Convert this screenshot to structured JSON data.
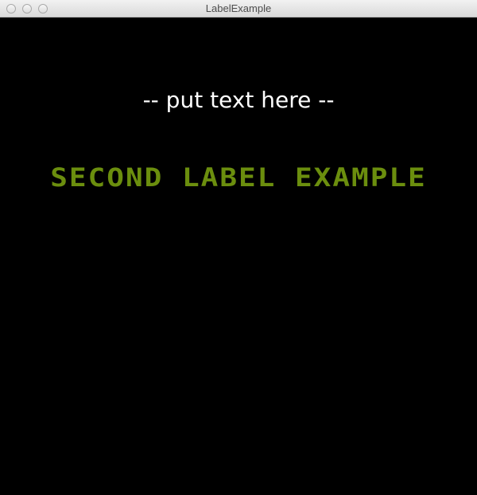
{
  "window": {
    "title": "LabelExample"
  },
  "labels": {
    "first": "-- put text here --",
    "second": "SECOND LABEL EXAMPLE"
  },
  "colors": {
    "background": "#000000",
    "first_label": "#ffffff",
    "second_label": "#6b8e0e"
  }
}
